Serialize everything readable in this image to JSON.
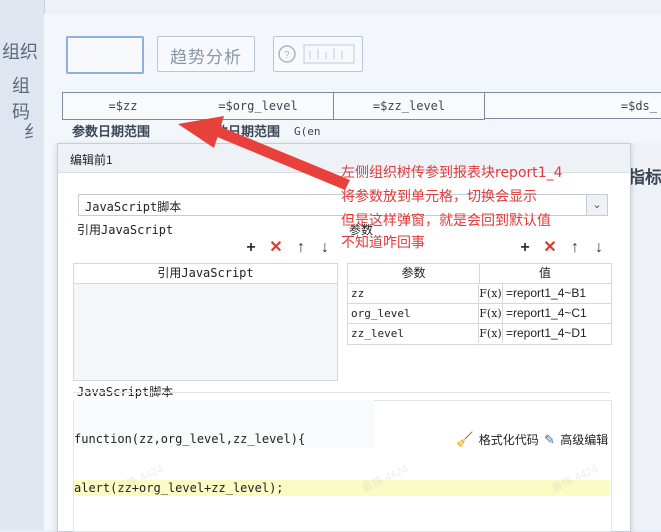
{
  "background": {
    "left_panel_chars": [
      "组织",
      "组",
      "码",
      "纟"
    ],
    "tabs": [
      "",
      "趋势分析",
      ""
    ],
    "table_headers": [
      "=$zz",
      "=$org_level",
      "=$zz_level",
      "=$ds_"
    ],
    "row_cells": [
      "参数日期范围",
      "参数日期范围",
      "G(en"
    ],
    "right_side_char": "指标"
  },
  "dialog": {
    "title": "编辑前1",
    "script_type": "JavaScript脚本",
    "ref_section_label": "引用JavaScript",
    "ref_table_header": "引用JavaScript",
    "param_section_label": "参数",
    "param_headers": [
      "参数",
      "值"
    ],
    "params": [
      {
        "name": "zz",
        "fx": "F(x)",
        "value": "=report1_4~B1"
      },
      {
        "name": "org_level",
        "fx": "F(x)",
        "value": "=report1_4~C1"
      },
      {
        "name": "zz_level",
        "fx": "F(x)",
        "value": "=report1_4~D1"
      }
    ],
    "script_section_label": "JavaScript脚本",
    "format_code_label": "格式化代码",
    "advanced_edit_label": "高级编辑",
    "code_lines": [
      "function(zz,org_level,zz_level){",
      "alert(zz+org_level+zz_level);"
    ]
  },
  "annotation": {
    "lines": [
      "左侧组织树传参到报表块report1_4",
      "将参数放到单元格，切换会显示",
      "但是这样弹窗，就是会回到默认值",
      "不知道咋回事"
    ],
    "color": "#e23a3a"
  },
  "watermark": "最锋 4424"
}
